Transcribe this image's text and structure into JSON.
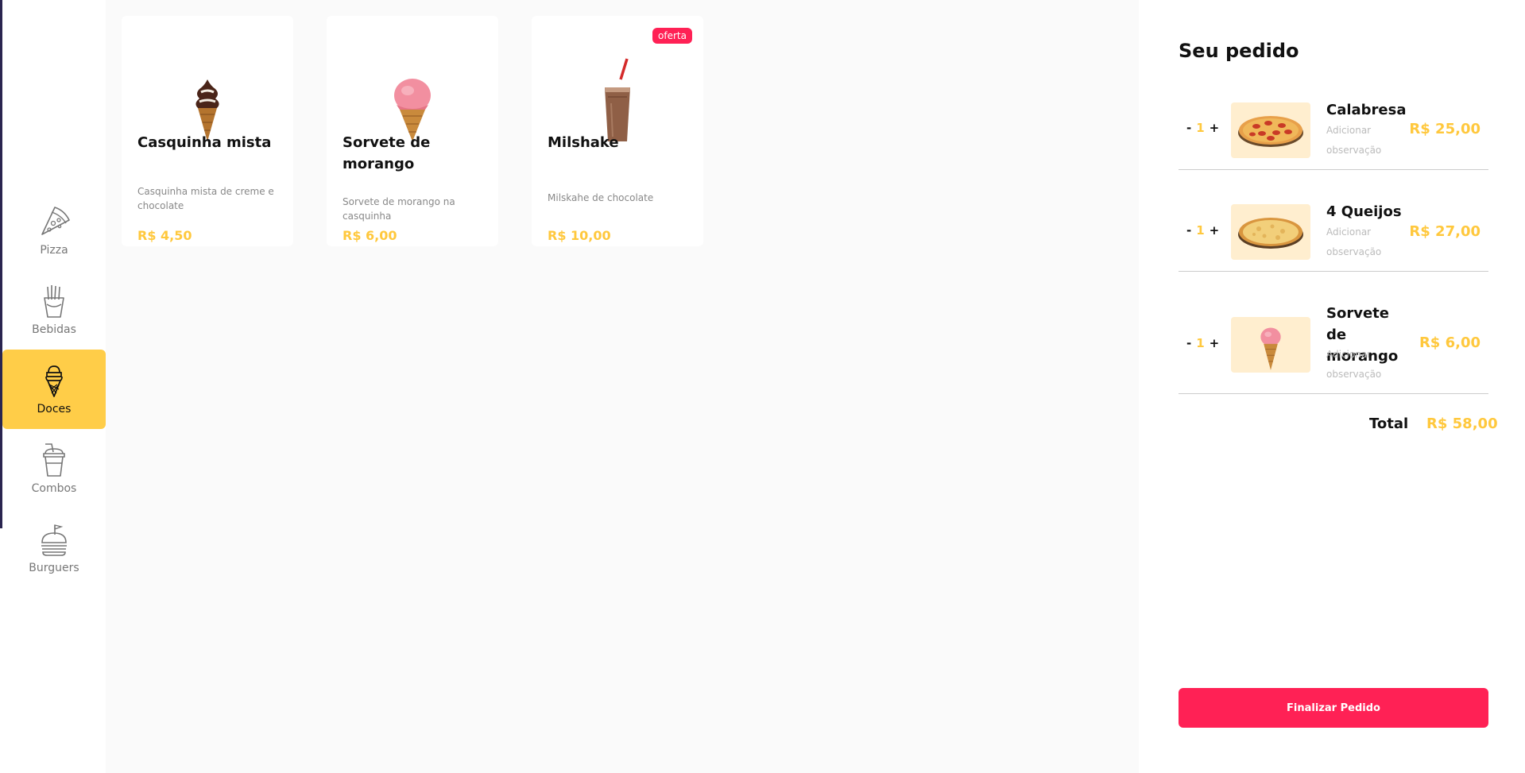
{
  "sidebar": {
    "items": [
      {
        "label": "Pizza",
        "icon": "pizza-icon"
      },
      {
        "label": "Bebidas",
        "icon": "fries-icon"
      },
      {
        "label": "Doces",
        "icon": "ice-cream-icon",
        "active": true
      },
      {
        "label": "Combos",
        "icon": "cup-icon"
      },
      {
        "label": "Burguers",
        "icon": "burger-icon"
      }
    ]
  },
  "products": [
    {
      "name": "Casquinha mista",
      "description": "Casquinha mista de creme e chocolate",
      "price": "R$ 4,50",
      "image": "mixed-cone-image"
    },
    {
      "name": "Sorvete de morango",
      "description": "Sorvete de morango na casquinha",
      "price": "R$ 6,00",
      "image": "strawberry-cone-image"
    },
    {
      "name": "Milshake",
      "description": "Milskahe de chocolate",
      "price": "R$ 10,00",
      "badge": "oferta",
      "image": "milkshake-image"
    }
  ],
  "order": {
    "title": "Seu pedido",
    "items": [
      {
        "qty": "1",
        "name": "Calabresa",
        "observation_placeholder": "Adicionar observação",
        "price": "R$ 25,00"
      },
      {
        "qty": "1",
        "name": "4 Queijos",
        "observation_placeholder": "Adicionar observação",
        "price": "R$ 27,00"
      },
      {
        "qty": "1",
        "name": "Sorvete de morango",
        "observation_placeholder": "Adicionar observação",
        "price": "R$ 6,00"
      }
    ],
    "minus": "-",
    "plus": "+",
    "total_label": "Total",
    "total_value": "R$ 58,00",
    "finalize_label": "Finalizar Pedido"
  },
  "colors": {
    "accent_yellow": "#ffcd48",
    "price_yellow": "#ffc83d",
    "primary_red": "#ff2155",
    "sidebar_accent": "#2a2550"
  }
}
